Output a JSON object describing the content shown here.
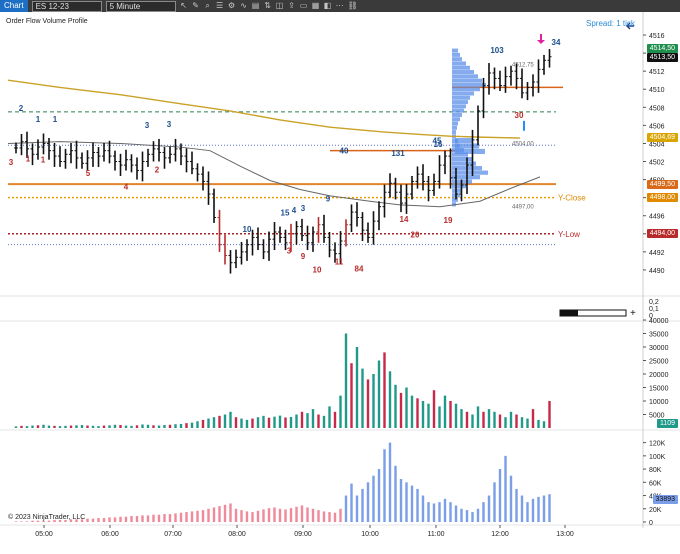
{
  "toolbar": {
    "tab": "Chart",
    "instrument": "ES 12-23",
    "interval": "5 Minute"
  },
  "indicator_title": "Order Flow Volume Profile",
  "spread": "Spread: 1 tick",
  "copyright": "© 2023 NinjaTrader, LLC",
  "price_axis": {
    "ticks": [
      "4516",
      "4514",
      "4512",
      "4510",
      "4508",
      "4506",
      "4504",
      "4502",
      "4500",
      "4498",
      "4496",
      "4494",
      "4492",
      "4490"
    ],
    "tags": [
      {
        "label": "4514,50",
        "color": "#1f8f4e"
      },
      {
        "label": "4513,50",
        "color": "#111111"
      },
      {
        "label": "4504,69",
        "color": "#d9a400"
      },
      {
        "label": "4499,50",
        "color": "#d86a1a"
      },
      {
        "label": "4498,00",
        "color": "#e08a00"
      },
      {
        "label": "4494,00",
        "color": "#b82b2b"
      }
    ]
  },
  "small_axis": {
    "ticks": [
      "0,2",
      "0,1",
      "0"
    ]
  },
  "volume_axis": {
    "ticks": [
      "40000",
      "35000",
      "30000",
      "25000",
      "20000",
      "15000",
      "10000",
      "5000"
    ],
    "tag": "1109"
  },
  "cum_axis": {
    "ticks": [
      "120K",
      "100K",
      "80K",
      "60K",
      "40K",
      "20K",
      "0"
    ],
    "tag": "33893"
  },
  "time_axis": [
    "05:00",
    "06:00",
    "07:00",
    "08:00",
    "09:00",
    "10:00",
    "11:00",
    "12:00",
    "13:00"
  ],
  "level_labels": {
    "y_close": "Y-Close",
    "y_low": "Y-Low"
  },
  "profile_labels": [
    "4512,75",
    "4504,00",
    "4497,00"
  ],
  "swing_labels": [
    {
      "text": "2",
      "color": "#1c4e8c"
    },
    {
      "text": "1",
      "color": "#1c4e8c"
    },
    {
      "text": "1",
      "color": "#1c4e8c"
    },
    {
      "text": "3",
      "color": "#1c4e8c"
    },
    {
      "text": "3",
      "color": "#1c4e8c"
    },
    {
      "text": "40",
      "color": "#1c4e8c"
    },
    {
      "text": "131",
      "color": "#1c4e8c"
    },
    {
      "text": "16",
      "color": "#1c4e8c"
    },
    {
      "text": "45",
      "color": "#1c4e8c"
    },
    {
      "text": "103",
      "color": "#1c4e8c"
    },
    {
      "text": "34",
      "color": "#1c4e8c"
    },
    {
      "text": "15",
      "color": "#1c4e8c"
    },
    {
      "text": "4",
      "color": "#1c4e8c"
    },
    {
      "text": "3",
      "color": "#1c4e8c"
    },
    {
      "text": "9",
      "color": "#1c4e8c"
    },
    {
      "text": "10",
      "color": "#1c4e8c"
    },
    {
      "text": "3",
      "color": "#b82b2b"
    },
    {
      "text": "1",
      "color": "#b82b2b"
    },
    {
      "text": "1",
      "color": "#b82b2b"
    },
    {
      "text": "5",
      "color": "#b82b2b"
    },
    {
      "text": "4",
      "color": "#b82b2b"
    },
    {
      "text": "2",
      "color": "#b82b2b"
    },
    {
      "text": "3",
      "color": "#b82b2b"
    },
    {
      "text": "9",
      "color": "#b82b2b"
    },
    {
      "text": "10",
      "color": "#b82b2b"
    },
    {
      "text": "11",
      "color": "#b82b2b"
    },
    {
      "text": "84",
      "color": "#b82b2b"
    },
    {
      "text": "14",
      "color": "#b82b2b"
    },
    {
      "text": "20",
      "color": "#b82b2b"
    },
    {
      "text": "19",
      "color": "#b82b2b"
    },
    {
      "text": "30",
      "color": "#b82b2b"
    }
  ],
  "chart_data": {
    "type": "bar",
    "x": [
      "04:40",
      "04:45",
      "04:50",
      "04:55",
      "05:00",
      "05:05",
      "05:10",
      "05:15",
      "05:20",
      "05:25",
      "05:30",
      "05:35",
      "05:40",
      "05:45",
      "05:50",
      "05:55",
      "06:00",
      "06:05",
      "06:10",
      "06:15",
      "06:20",
      "06:25",
      "06:30",
      "06:35",
      "06:40",
      "06:45",
      "06:50",
      "06:55",
      "07:00",
      "07:05",
      "07:10",
      "07:15",
      "07:20",
      "07:25",
      "07:30",
      "07:35",
      "07:40",
      "07:45",
      "07:50",
      "07:55",
      "08:00",
      "08:05",
      "08:10",
      "08:15",
      "08:20",
      "08:25",
      "08:30",
      "08:35",
      "08:40",
      "08:45",
      "08:50",
      "08:55",
      "09:00",
      "09:05",
      "09:10",
      "09:15",
      "09:20",
      "09:25",
      "09:30",
      "09:35",
      "09:40",
      "09:45",
      "09:50",
      "09:55",
      "10:00",
      "10:05",
      "10:10",
      "10:15",
      "10:20",
      "10:25",
      "10:30",
      "10:35",
      "10:40",
      "10:45",
      "10:50",
      "10:55",
      "11:00",
      "11:05",
      "11:10",
      "11:15",
      "11:20",
      "11:25",
      "11:30",
      "11:35",
      "11:40",
      "11:45",
      "11:50",
      "11:55",
      "12:00",
      "12:05",
      "12:10",
      "12:15",
      "12:20",
      "12:25",
      "12:30",
      "12:35",
      "12:40",
      "12:45"
    ],
    "volume": [
      600,
      800,
      700,
      900,
      1000,
      1200,
      900,
      800,
      700,
      800,
      900,
      1000,
      1100,
      900,
      800,
      700,
      900,
      1000,
      1200,
      1100,
      900,
      800,
      1000,
      1300,
      1200,
      1000,
      900,
      1100,
      1200,
      1400,
      1500,
      1800,
      2000,
      2500,
      3000,
      3500,
      4000,
      4500,
      5000,
      6000,
      4000,
      3500,
      3000,
      3500,
      4000,
      4500,
      3800,
      4200,
      4600,
      3900,
      4100,
      5000,
      6000,
      5500,
      7000,
      5000,
      4500,
      8000,
      6000,
      12000,
      35000,
      24000,
      30000,
      22000,
      18000,
      20000,
      25000,
      28000,
      21000,
      16000,
      13000,
      15000,
      12000,
      11000,
      10000,
      9000,
      14000,
      8000,
      12000,
      10000,
      9000,
      7000,
      6000,
      5000,
      8000,
      6000,
      7000,
      6000,
      5000,
      4000,
      6000,
      5000,
      4000,
      3500,
      7000,
      3000,
      2500,
      10000
    ],
    "cum_delta_k": [
      1,
      1,
      1,
      2,
      2,
      2,
      2,
      3,
      3,
      3,
      4,
      4,
      4,
      5,
      5,
      6,
      6,
      7,
      7,
      8,
      8,
      9,
      9,
      10,
      10,
      11,
      11,
      12,
      12,
      13,
      14,
      15,
      16,
      17,
      18,
      20,
      22,
      24,
      26,
      28,
      20,
      18,
      16,
      15,
      17,
      19,
      21,
      22,
      20,
      19,
      21,
      23,
      25,
      22,
      20,
      18,
      16,
      15,
      14,
      20,
      40,
      58,
      40,
      50,
      60,
      70,
      80,
      110,
      120,
      85,
      65,
      60,
      55,
      50,
      40,
      30,
      28,
      30,
      35,
      30,
      25,
      20,
      18,
      15,
      20,
      30,
      40,
      60,
      80,
      100,
      70,
      50,
      40,
      30,
      35,
      38,
      40,
      42
    ],
    "price_ylim": [
      4488,
      4517
    ],
    "volume_ylim": [
      0,
      40000
    ],
    "cum_ylim": [
      0,
      130
    ]
  }
}
